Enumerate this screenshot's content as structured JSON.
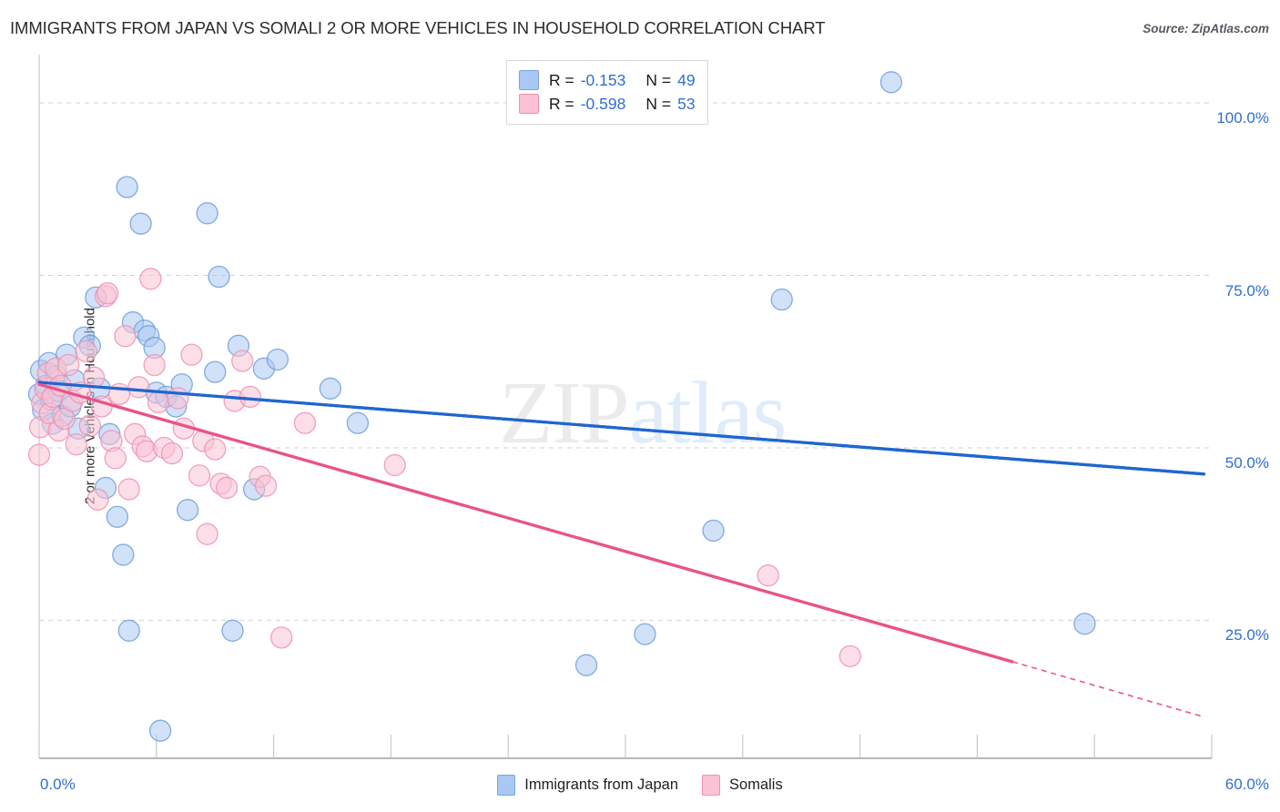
{
  "header": {
    "title": "IMMIGRANTS FROM JAPAN VS SOMALI 2 OR MORE VEHICLES IN HOUSEHOLD CORRELATION CHART",
    "source": "Source: ZipAtlas.com"
  },
  "watermark": {
    "part1": "ZIP",
    "part2": "atlas"
  },
  "stat_legend": {
    "rows": [
      {
        "r_key": "R =",
        "r_value": "-0.153",
        "n_key": "N =",
        "n_value": "49",
        "color": "#a9c9f2"
      },
      {
        "r_key": "R =",
        "r_value": "-0.598",
        "n_key": "N =",
        "n_value": "53",
        "color": "#fac2d4"
      }
    ]
  },
  "axes": {
    "y_title": "2 or more Vehicles in Household",
    "y_ticks": [
      "100.0%",
      "75.0%",
      "50.0%",
      "25.0%"
    ],
    "x_min_label": "0.0%",
    "x_max_label": "60.0%"
  },
  "series_legend": [
    {
      "label": "Immigrants from Japan",
      "color": "#a9c9f2",
      "border": "#7aa6dd"
    },
    {
      "label": "Somalis",
      "color": "#fac2d4",
      "border": "#ef92b1"
    }
  ],
  "chart_data": {
    "type": "scatter",
    "title": "IMMIGRANTS FROM JAPAN VS SOMALI 2 OR MORE VEHICLES IN HOUSEHOLD CORRELATION CHART",
    "xlabel": "",
    "ylabel": "2 or more Vehicles in Household",
    "xlim": [
      0.0,
      60.0
    ],
    "ylim": [
      5.0,
      107.0
    ],
    "x_ticks": [
      0.0,
      6.0,
      12.0,
      18.0,
      24.0,
      30.0,
      36.0,
      42.0,
      48.0,
      54.0,
      60.0
    ],
    "y_ticks": [
      25.0,
      50.0,
      75.0,
      100.0
    ],
    "x_tick_labels_shown": [
      "0.0%",
      "60.0%"
    ],
    "y_tick_labels_shown": [
      "25.0%",
      "50.0%",
      "75.0%",
      "100.0%"
    ],
    "grid": "horizontal-dashed",
    "legend_position": "bottom-center",
    "series": [
      {
        "name": "Immigrants from Japan",
        "color": "#a9c9f2",
        "border": "#6f9fd8",
        "R": -0.153,
        "N": 49,
        "trendline": {
          "style": "solid",
          "color": "#1f66d0",
          "x0": 0.0,
          "y0": 59.5,
          "x1": 59.6,
          "y1": 46.2
        },
        "points": [
          [
            0.0,
            57.8
          ],
          [
            0.1,
            61.2
          ],
          [
            0.2,
            55.5
          ],
          [
            0.35,
            59.0
          ],
          [
            0.5,
            62.3
          ],
          [
            0.6,
            57.0
          ],
          [
            0.7,
            53.5
          ],
          [
            0.9,
            60.4
          ],
          [
            1.0,
            58.2
          ],
          [
            1.2,
            54.6
          ],
          [
            1.4,
            63.5
          ],
          [
            1.6,
            56.0
          ],
          [
            1.8,
            59.8
          ],
          [
            2.0,
            52.8
          ],
          [
            2.3,
            66.0
          ],
          [
            2.6,
            64.8
          ],
          [
            2.9,
            71.8
          ],
          [
            3.1,
            58.6
          ],
          [
            3.4,
            44.2
          ],
          [
            3.6,
            52.0
          ],
          [
            4.0,
            40.0
          ],
          [
            4.3,
            34.5
          ],
          [
            4.5,
            87.8
          ],
          [
            4.6,
            23.5
          ],
          [
            4.8,
            68.2
          ],
          [
            5.2,
            82.5
          ],
          [
            5.4,
            67.0
          ],
          [
            5.6,
            66.2
          ],
          [
            5.9,
            64.5
          ],
          [
            6.0,
            58.0
          ],
          [
            6.2,
            9.0
          ],
          [
            6.5,
            57.4
          ],
          [
            7.0,
            56.0
          ],
          [
            7.3,
            59.2
          ],
          [
            7.6,
            41.0
          ],
          [
            8.6,
            84.0
          ],
          [
            9.0,
            61.0
          ],
          [
            9.2,
            74.8
          ],
          [
            9.9,
            23.5
          ],
          [
            10.2,
            64.8
          ],
          [
            11.0,
            44.0
          ],
          [
            11.5,
            61.5
          ],
          [
            12.2,
            62.8
          ],
          [
            14.9,
            58.6
          ],
          [
            16.3,
            53.6
          ],
          [
            28.0,
            18.5
          ],
          [
            31.0,
            23.0
          ],
          [
            34.5,
            38.0
          ],
          [
            38.0,
            71.5
          ],
          [
            43.6,
            103.0
          ],
          [
            53.5,
            24.5
          ]
        ]
      },
      {
        "name": "Somalis",
        "color": "#fac2d4",
        "border": "#ef92b1",
        "R": -0.598,
        "N": 53,
        "trendline": {
          "style": "solid-then-dashed",
          "color": "#e8538a",
          "x0": 0.0,
          "y0": 59.2,
          "x1": 49.8,
          "y1": 19.0,
          "dash_x1": 59.6,
          "dash_y1": 11.0
        },
        "points": [
          [
            0.0,
            49.0
          ],
          [
            0.05,
            53.0
          ],
          [
            0.15,
            56.5
          ],
          [
            0.3,
            58.6
          ],
          [
            0.45,
            60.8
          ],
          [
            0.55,
            55.0
          ],
          [
            0.7,
            57.4
          ],
          [
            0.85,
            61.5
          ],
          [
            1.0,
            52.5
          ],
          [
            1.1,
            59.0
          ],
          [
            1.3,
            54.2
          ],
          [
            1.5,
            62.0
          ],
          [
            1.7,
            56.8
          ],
          [
            1.9,
            50.5
          ],
          [
            2.1,
            58.0
          ],
          [
            2.4,
            64.0
          ],
          [
            2.6,
            53.2
          ],
          [
            2.8,
            60.2
          ],
          [
            3.0,
            42.5
          ],
          [
            3.2,
            56.0
          ],
          [
            3.4,
            72.0
          ],
          [
            3.5,
            72.4
          ],
          [
            3.7,
            51.0
          ],
          [
            3.9,
            48.5
          ],
          [
            4.1,
            57.8
          ],
          [
            4.4,
            66.2
          ],
          [
            4.6,
            44.0
          ],
          [
            4.9,
            52.0
          ],
          [
            5.1,
            58.8
          ],
          [
            5.3,
            50.2
          ],
          [
            5.5,
            49.5
          ],
          [
            5.7,
            74.5
          ],
          [
            5.9,
            62.0
          ],
          [
            6.1,
            56.6
          ],
          [
            6.4,
            50.0
          ],
          [
            6.8,
            49.2
          ],
          [
            7.1,
            57.2
          ],
          [
            7.4,
            52.8
          ],
          [
            7.8,
            63.5
          ],
          [
            8.2,
            46.0
          ],
          [
            8.4,
            51.0
          ],
          [
            8.6,
            37.5
          ],
          [
            9.0,
            49.8
          ],
          [
            9.3,
            44.8
          ],
          [
            9.6,
            44.2
          ],
          [
            10.0,
            56.8
          ],
          [
            10.4,
            62.6
          ],
          [
            10.8,
            57.4
          ],
          [
            11.3,
            45.8
          ],
          [
            11.6,
            44.5
          ],
          [
            12.4,
            22.5
          ],
          [
            13.6,
            53.6
          ],
          [
            18.2,
            47.5
          ],
          [
            37.3,
            31.5
          ],
          [
            41.5,
            19.8
          ]
        ]
      }
    ]
  }
}
